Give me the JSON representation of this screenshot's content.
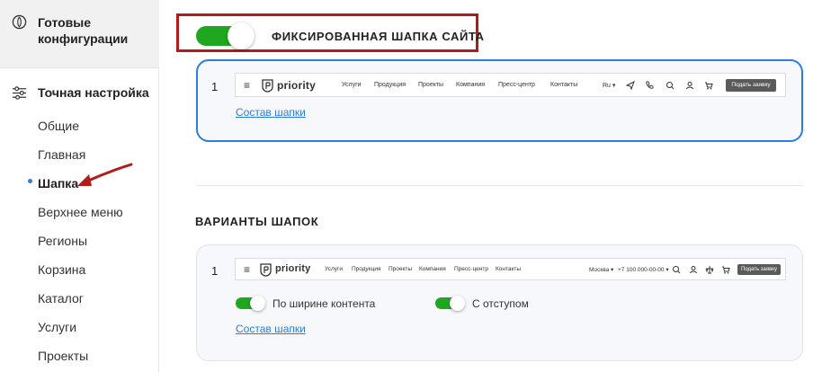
{
  "sidebar": {
    "ready_configs": {
      "label": "Готовые конфигурации",
      "icon": "palette-icon"
    },
    "fine_tuning": {
      "label": "Точная настройка",
      "icon": "sliders-icon"
    },
    "items": [
      {
        "label": "Общие",
        "active": false
      },
      {
        "label": "Главная",
        "active": false
      },
      {
        "label": "Шапка",
        "active": true
      },
      {
        "label": "Верхнее меню",
        "active": false
      },
      {
        "label": "Регионы",
        "active": false
      },
      {
        "label": "Корзина",
        "active": false
      },
      {
        "label": "Каталог",
        "active": false
      },
      {
        "label": "Услуги",
        "active": false
      },
      {
        "label": "Проекты",
        "active": false
      }
    ]
  },
  "fixed_header": {
    "toggle_on": true,
    "label": "ФИКСИРОВАННАЯ ШАПКА САЙТА",
    "highlight_color": "#b31b1b",
    "card": {
      "index": "1",
      "preview": {
        "logo": "priority",
        "nav": [
          "Услуги",
          "Продукция",
          "Проекты",
          "Компания",
          "Пресс-центр",
          "Контакты"
        ],
        "lang": "Ru",
        "button": "Подать заявку"
      },
      "link": "Состав шапки"
    }
  },
  "variants": {
    "title": "ВАРИАНТЫ ШАПОК",
    "card": {
      "index": "1",
      "preview": {
        "logo": "priority",
        "nav": [
          "Услуги",
          "Продукция",
          "Проекты",
          "Компания",
          "Пресс-центр",
          "Контакты"
        ],
        "city": "Москва",
        "phone": "+7 100 000-00-00",
        "button": "Подать заявку"
      },
      "options": [
        {
          "label": "По ширине контента",
          "on": true
        },
        {
          "label": "С отступом",
          "on": true
        }
      ],
      "link": "Состав шапки"
    }
  },
  "colors": {
    "toggle_on": "#1fa81f",
    "accent": "#2b7de0",
    "arrow": "#b31b1b"
  }
}
